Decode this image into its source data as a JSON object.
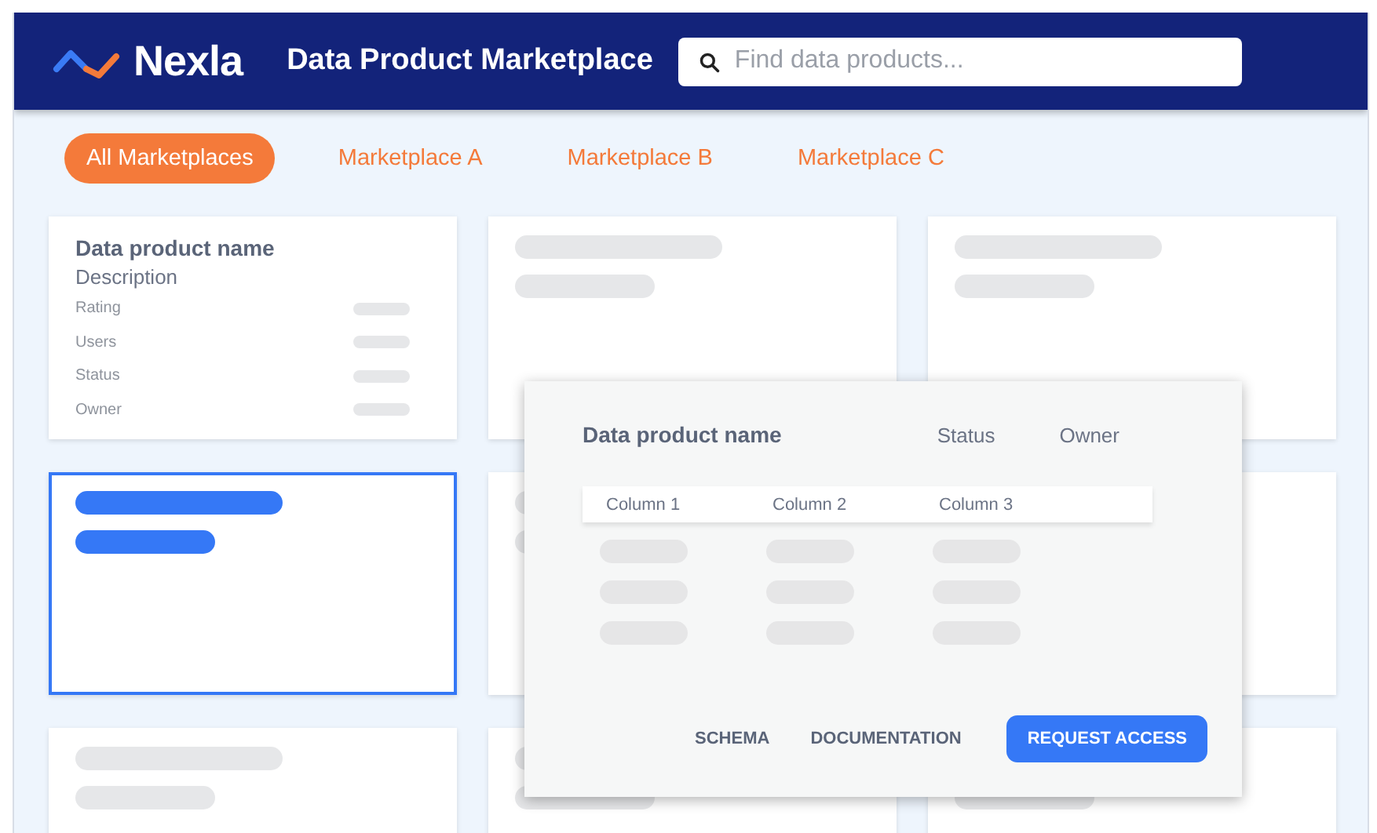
{
  "header": {
    "brand": "Nexla",
    "title": "Data Product Marketplace",
    "search": {
      "placeholder": "Find data products..."
    }
  },
  "tabs": [
    {
      "label": "All Marketplaces",
      "selected": true
    },
    {
      "label": "Marketplace A",
      "selected": false
    },
    {
      "label": "Marketplace B",
      "selected": false
    },
    {
      "label": "Marketplace C",
      "selected": false
    }
  ],
  "cards": [
    {
      "kind": "detail",
      "selected": false,
      "name": "Data product name",
      "description": "Description",
      "fields": [
        "Rating",
        "Users",
        "Status",
        "Owner"
      ]
    },
    {
      "kind": "skeleton",
      "selected": false
    },
    {
      "kind": "skeleton",
      "selected": false
    },
    {
      "kind": "skeleton",
      "selected": true
    },
    {
      "kind": "skeleton",
      "selected": false
    },
    {
      "kind": "covered",
      "selected": false
    },
    {
      "kind": "skeleton",
      "selected": false
    },
    {
      "kind": "skeleton",
      "selected": false
    },
    {
      "kind": "lower",
      "selected": false
    }
  ],
  "popup": {
    "name": "Data product name",
    "meta": [
      "Status",
      "Owner"
    ],
    "columns": [
      "Column 1",
      "Column 2",
      "Column 3"
    ],
    "actions": [
      {
        "label": "SCHEMA",
        "kind": "text"
      },
      {
        "label": "DOCUMENTATION",
        "kind": "text"
      },
      {
        "label": "REQUEST ACCESS",
        "kind": "primary"
      }
    ]
  }
}
